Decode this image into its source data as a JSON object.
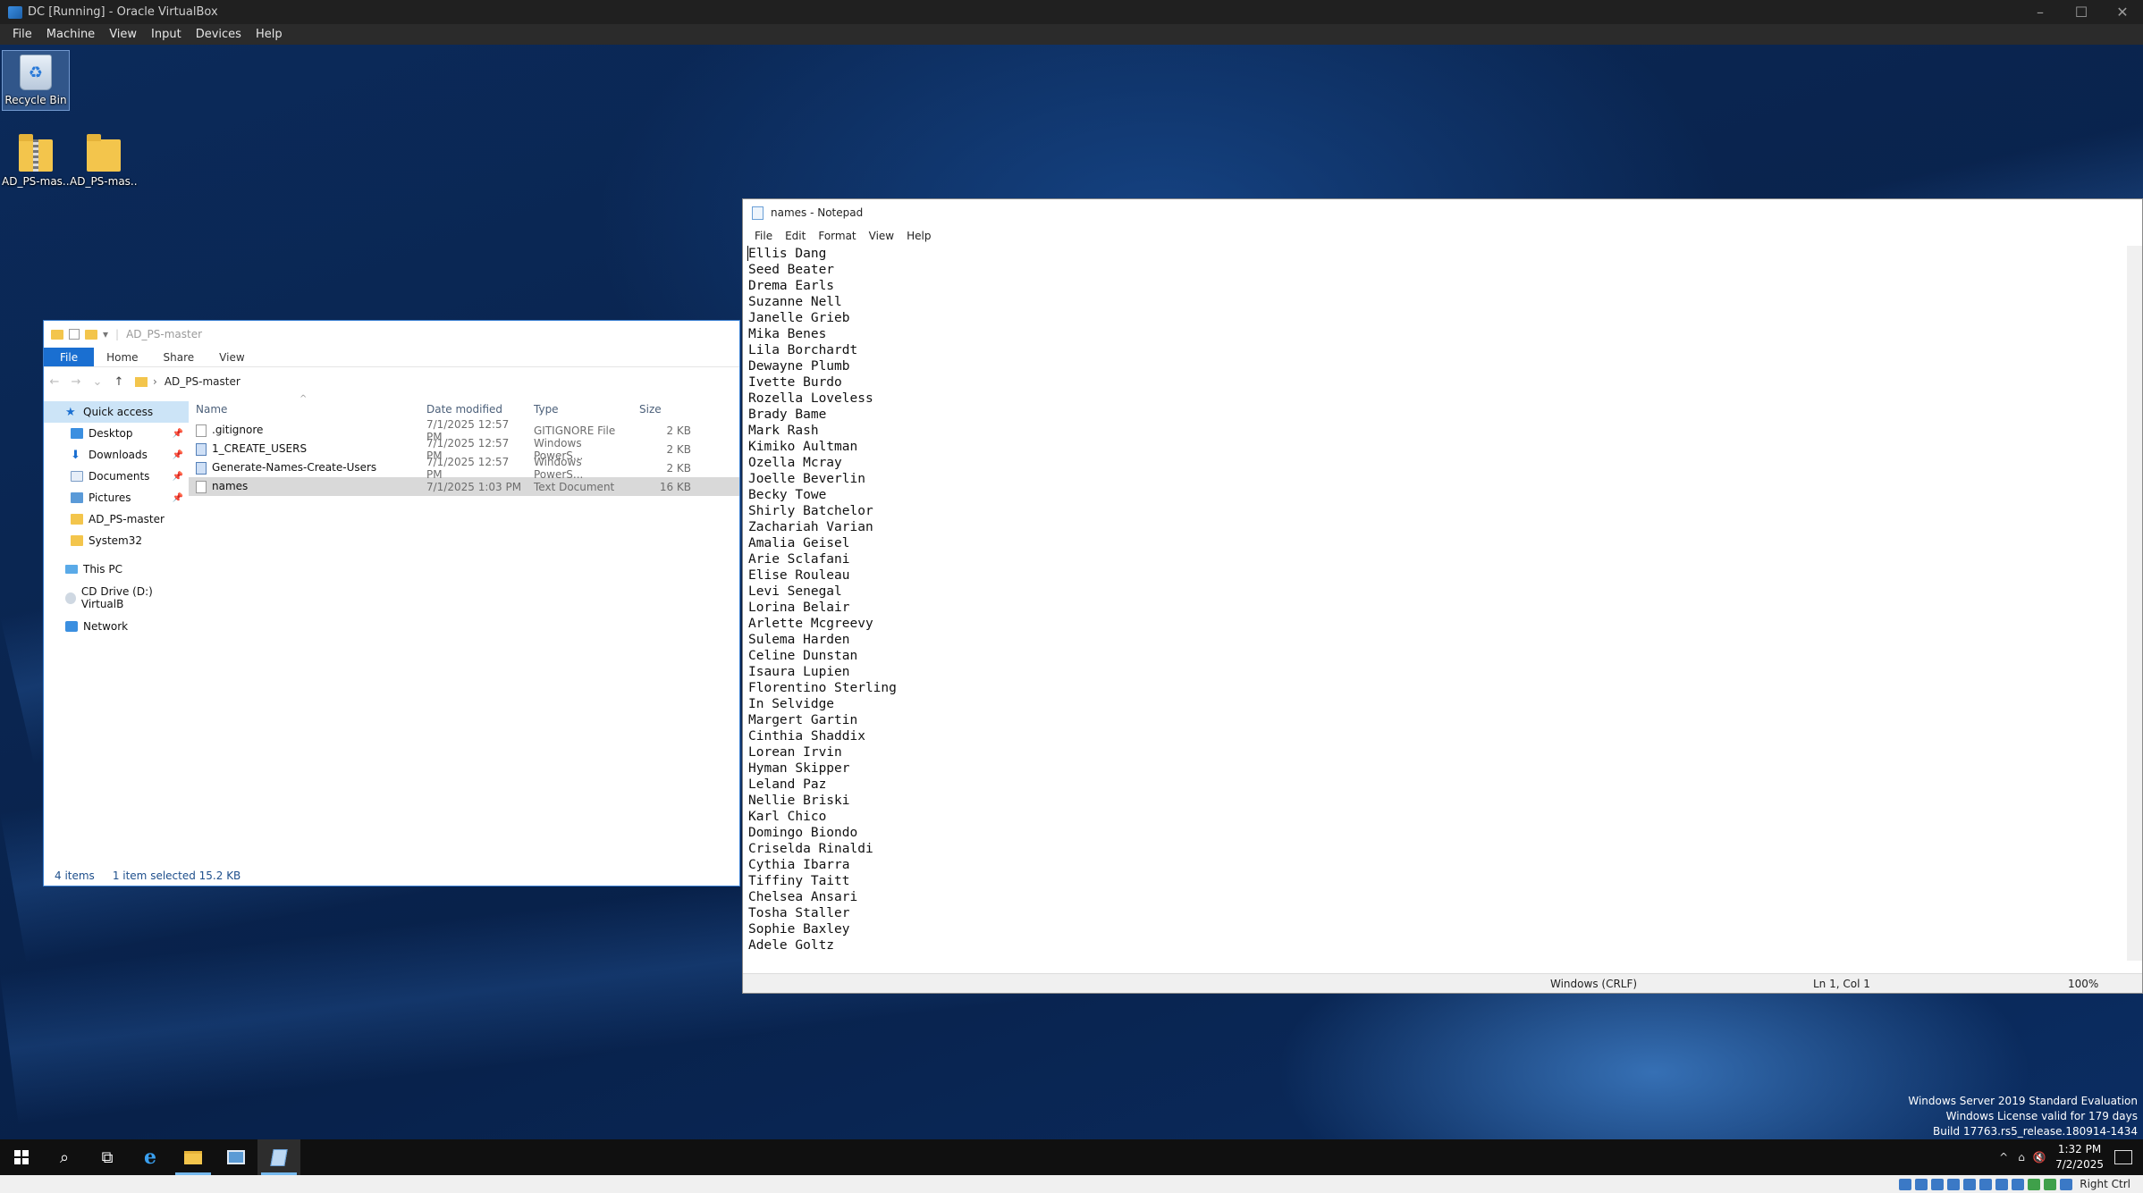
{
  "host": {
    "title": "DC [Running] - Oracle VirtualBox",
    "menu": [
      "File",
      "Machine",
      "View",
      "Input",
      "Devices",
      "Help"
    ],
    "controls": {
      "minimize": "–",
      "maximize": "☐",
      "close": "✕"
    },
    "host_key": "Right Ctrl"
  },
  "desktop": {
    "icons": [
      {
        "label": "Recycle Bin"
      },
      {
        "label": "AD_PS-mas..."
      },
      {
        "label": "AD_PS-mas..."
      }
    ]
  },
  "explorer": {
    "title": "AD_PS-master",
    "ribbon": [
      "File",
      "Home",
      "Share",
      "View"
    ],
    "breadcrumb": "AD_PS-master",
    "nav": {
      "quick_access": "Quick access",
      "desktop": "Desktop",
      "downloads": "Downloads",
      "documents": "Documents",
      "pictures": "Pictures",
      "folder1": "AD_PS-master",
      "folder2": "System32",
      "this_pc": "This PC",
      "cd_drive": "CD Drive (D:) VirtualB",
      "network": "Network"
    },
    "columns": {
      "name": "Name",
      "date": "Date modified",
      "type": "Type",
      "size": "Size"
    },
    "files": [
      {
        "name": ".gitignore",
        "date": "7/1/2025 12:57 PM",
        "type": "GITIGNORE File",
        "size": "2 KB"
      },
      {
        "name": "1_CREATE_USERS",
        "date": "7/1/2025 12:57 PM",
        "type": "Windows PowerS...",
        "size": "2 KB"
      },
      {
        "name": "Generate-Names-Create-Users",
        "date": "7/1/2025 12:57 PM",
        "type": "Windows PowerS...",
        "size": "2 KB"
      },
      {
        "name": "names",
        "date": "7/1/2025 1:03 PM",
        "type": "Text Document",
        "size": "16 KB"
      }
    ],
    "status": {
      "count": "4 items",
      "selection": "1 item selected  15.2 KB"
    }
  },
  "notepad": {
    "title": "names - Notepad",
    "menu": [
      "File",
      "Edit",
      "Format",
      "View",
      "Help"
    ],
    "lines": [
      "Ellis Dang",
      "Seed Beater",
      "Drema Earls",
      "Suzanne Nell",
      "Janelle Grieb",
      "Mika Benes",
      "Lila Borchardt",
      "Dewayne Plumb",
      "Ivette Burdo",
      "Rozella Loveless",
      "Brady Bame",
      "Mark Rash",
      "Kimiko Aultman",
      "Ozella Mcray",
      "Joelle Beverlin",
      "Becky Towe",
      "Shirly Batchelor",
      "Zachariah Varian",
      "Amalia Geisel",
      "Arie Sclafani",
      "Elise Rouleau",
      "Levi Senegal",
      "Lorina Belair",
      "Arlette Mcgreevy",
      "Sulema Harden",
      "Celine Dunstan",
      "Isaura Lupien",
      "Florentino Sterling",
      "In Selvidge",
      "Margert Gartin",
      "Cinthia Shaddix",
      "Lorean Irvin",
      "Hyman Skipper",
      "Leland Paz",
      "Nellie Briski",
      "Karl Chico",
      "Domingo Biondo",
      "Criselda Rinaldi",
      "Cythia Ibarra",
      "Tiffiny Taitt",
      "Chelsea Ansari",
      "Tosha Staller",
      "Sophie Baxley",
      "Adele Goltz"
    ],
    "status": {
      "encoding": "Windows (CRLF)",
      "position": "Ln 1, Col 1",
      "zoom": "100%"
    }
  },
  "watermark": {
    "line1": "Windows Server 2019 Standard Evaluation",
    "line2": "Windows License valid for 179 days",
    "line3": "Build 17763.rs5_release.180914-1434"
  },
  "taskbar": {
    "time": "1:32 PM",
    "date": "7/2/2025",
    "tray_expand": "^"
  }
}
